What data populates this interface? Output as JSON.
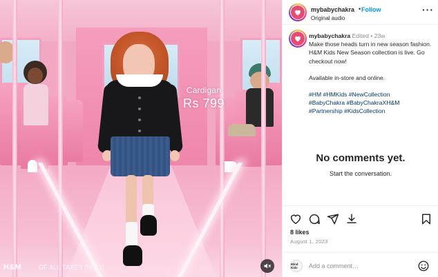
{
  "media": {
    "price_tag": {
      "item": "Cardigan",
      "price": "Rs 799"
    },
    "brand_logo": "H&M",
    "disclaimer": "OF ALL TAXES PER U"
  },
  "header": {
    "username": "mybabychakra",
    "dot": "•",
    "follow_label": "Follow",
    "audio_label": "Original audio",
    "more": "···"
  },
  "caption": {
    "username": "mybabychakra",
    "meta": "Edited • 23w",
    "lines": [
      "Make those heads turn in new season fashion.",
      "H&M Kids New Season collection is live. Go checkout now!",
      "Available in-store and online."
    ],
    "hashtags": [
      "#HM #HMKids #NewCollection",
      "#BabyChakra #BabyChakraXH&M",
      "#Partnership #KidsCollection"
    ]
  },
  "comments": {
    "empty_title": "No comments yet.",
    "empty_subtitle": "Start the conversation."
  },
  "stats": {
    "likes": "8 likes",
    "date": "August 1, 2023"
  },
  "comment_box": {
    "avatar_text": "Mind Kidz",
    "placeholder": "Add a comment…"
  },
  "icons": {
    "like": "heart-icon",
    "comment": "comment-icon",
    "share": "send-icon",
    "save": "bookmark-icon",
    "emoji": "smiley-icon",
    "mute": "speaker-muted-icon"
  },
  "colors": {
    "follow": "#0095f6",
    "hashtag": "#00376b",
    "meta": "#8e8e8e",
    "media_bg": "#f2a7c3"
  }
}
